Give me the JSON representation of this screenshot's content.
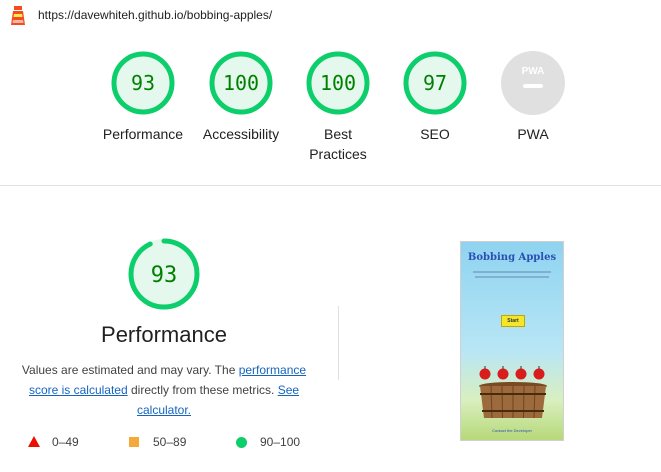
{
  "header": {
    "url": "https://davewhiteh.github.io/bobbing-apples/",
    "logo_icon": "lighthouse-logo-icon"
  },
  "categories": [
    {
      "label": "Performance",
      "score": 93,
      "color": "#0cce6b"
    },
    {
      "label": "Accessibility",
      "score": 100,
      "color": "#0cce6b"
    },
    {
      "label": "Best Practices",
      "score": 100,
      "color": "#0cce6b"
    },
    {
      "label": "SEO",
      "score": 97,
      "color": "#0cce6b"
    },
    {
      "label": "PWA",
      "badge": "PWA",
      "score": null,
      "color": "#e0e0e0"
    }
  ],
  "performance": {
    "score": "93",
    "title": "Performance",
    "desc_prefix": "Values are estimated and may vary. The ",
    "link_score": "performance score is calculated",
    "desc_middle": " directly from these metrics. ",
    "link_calc": "See calculator."
  },
  "legend": [
    {
      "range": "0–49",
      "icon": "triangle-fail-icon",
      "color": "#eb0f00"
    },
    {
      "range": "50–89",
      "icon": "square-average-icon",
      "color": "#f4a93a"
    },
    {
      "range": "90–100",
      "icon": "circle-pass-icon",
      "color": "#0cce6b"
    }
  ],
  "screenshot": {
    "title": "Bobbing Apples",
    "button": "Start",
    "footer": "Contact the Developer"
  }
}
